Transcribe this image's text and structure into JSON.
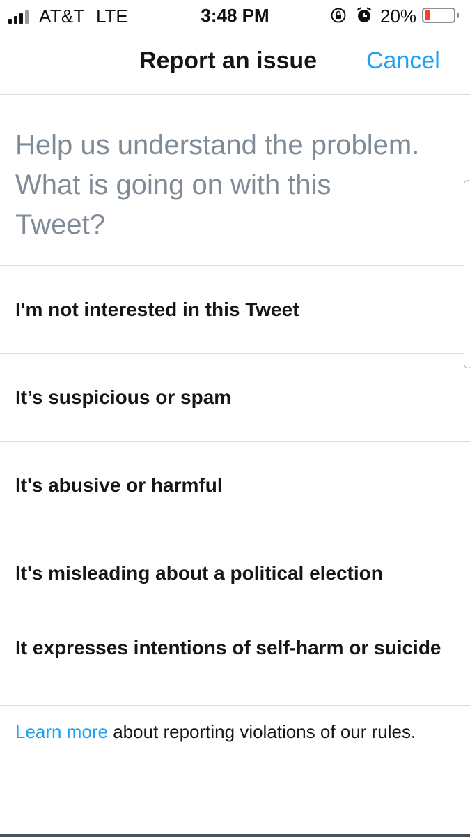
{
  "status_bar": {
    "carrier": "AT&T",
    "network": "LTE",
    "time": "3:48 PM",
    "battery_percent": "20%",
    "battery_level": 0.2,
    "battery_color": "#ff3b30",
    "signal_bars_active": 3,
    "signal_bars_total": 4,
    "icons": [
      "orientation-lock-icon",
      "alarm-icon",
      "battery-icon"
    ]
  },
  "header": {
    "title": "Report an issue",
    "cancel_label": "Cancel"
  },
  "prompt": {
    "lines": [
      "Help us understand the problem.",
      "What is going on with this",
      "Tweet?"
    ]
  },
  "options": [
    {
      "label": "I'm not interested in this Tweet"
    },
    {
      "label": "It’s suspicious or spam"
    },
    {
      "label": "It's abusive or harmful"
    },
    {
      "label": "It's misleading about a political election"
    },
    {
      "label": "It expresses intentions of self-harm or suicide"
    }
  ],
  "footer": {
    "link_text": "Learn more",
    "text": " about reporting violations of our rules."
  },
  "colors": {
    "accent": "#1da1f2",
    "prompt_text": "#7f8b96",
    "divider": "#d6dde3",
    "primary_text": "#14171a"
  }
}
